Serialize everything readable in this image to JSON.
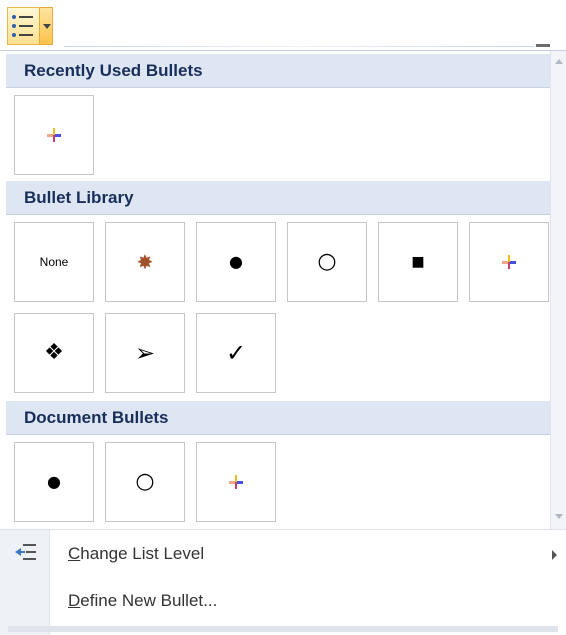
{
  "colors": {
    "header_bg": "#dde6f2",
    "header_text": "#1a2e5a",
    "cell_border": "#c6c6c6",
    "split_button_highlight": "#ffd37a"
  },
  "toolbar": {
    "bullets_button_icon": "bulleted-list-icon",
    "dropdown_icon": "dropdown-arrow-icon"
  },
  "sections": {
    "recent": {
      "title": "Recently Used Bullets",
      "items": [
        {
          "icon": "colored-cross-bullet-icon"
        }
      ]
    },
    "library": {
      "title": "Bullet Library",
      "items": [
        {
          "icon": "none-bullet",
          "label": "None"
        },
        {
          "icon": "starburst-bullet-icon",
          "glyph": "✸"
        },
        {
          "icon": "filled-circle-bullet-icon",
          "glyph": "●"
        },
        {
          "icon": "hollow-circle-bullet-icon",
          "glyph": "○"
        },
        {
          "icon": "filled-square-bullet-icon",
          "glyph": "■"
        },
        {
          "icon": "colored-cross-bullet-icon"
        },
        {
          "icon": "four-diamond-bullet-icon",
          "glyph": "❖"
        },
        {
          "icon": "arrowhead-bullet-icon",
          "glyph": "➢"
        },
        {
          "icon": "checkmark-bullet-icon",
          "glyph": "✓"
        }
      ]
    },
    "document": {
      "title": "Document Bullets",
      "items": [
        {
          "icon": "filled-circle-bullet-icon",
          "glyph": "●"
        },
        {
          "icon": "hollow-circle-bullet-icon",
          "glyph": "○"
        },
        {
          "icon": "colored-cross-bullet-icon"
        }
      ]
    }
  },
  "commands": [
    {
      "mnemonic": "C",
      "rest": "hange List Level",
      "icon": "change-list-level-icon",
      "has_submenu": true
    },
    {
      "mnemonic": "D",
      "rest": "efine New Bullet...",
      "icon": null,
      "has_submenu": false
    }
  ]
}
